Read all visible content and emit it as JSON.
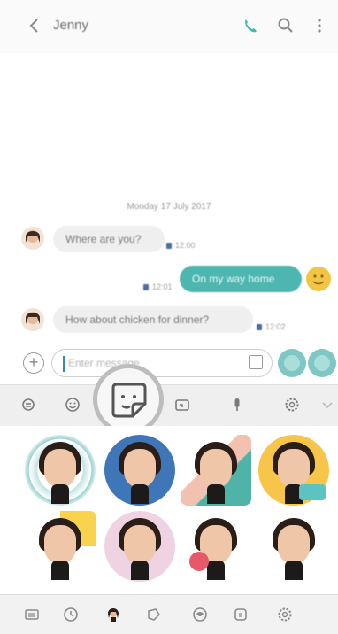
{
  "header": {
    "contact_name": "Jenny",
    "icons": [
      "back-icon",
      "phone-icon",
      "search-icon",
      "more-icon"
    ]
  },
  "conversation": {
    "date_label": "Monday 17 July 2017",
    "messages": [
      {
        "direction": "incoming",
        "text": "Where are you?",
        "time": "12:00"
      },
      {
        "direction": "outgoing",
        "text": "On my way home",
        "time": "12:01"
      },
      {
        "direction": "incoming",
        "text": "How about chicken for dinner?",
        "time": "12:02"
      }
    ]
  },
  "composer": {
    "placeholder": "Enter message"
  },
  "keyboard_toolbar": {
    "icons": [
      "emoji-swap-icon",
      "emoji-icon",
      "sticker-icon",
      "gif-icon",
      "mic-icon",
      "settings-icon",
      "chevron-down-icon"
    ]
  },
  "colors": {
    "accent": "#4eb6b1",
    "incoming_bubble": "#efefef",
    "toolbar_bg": "#efefef"
  },
  "bottom_tabs": {
    "icons": [
      "keyboard-icon",
      "recent-icon",
      "ar-emoji-icon",
      "sticker-pack-icon",
      "emoji-pack-icon",
      "gif-pack-icon",
      "settings-icon"
    ]
  }
}
